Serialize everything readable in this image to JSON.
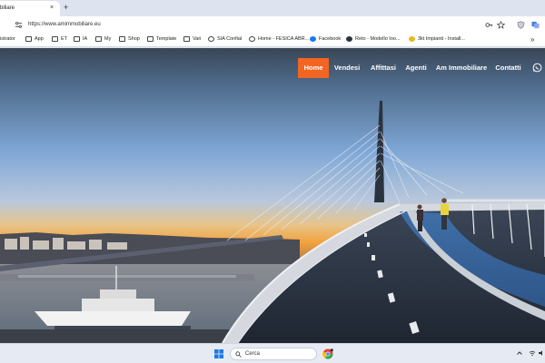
{
  "browser": {
    "tab_title": "biliare",
    "tab_close": "×",
    "new_tab": "+",
    "url": "https://www.amimmobiliare.eu",
    "bookmarks": [
      {
        "label": "istrator",
        "icon": "none"
      },
      {
        "label": "App",
        "icon": "folder-icon"
      },
      {
        "label": "ET",
        "icon": "folder-icon"
      },
      {
        "label": "IA",
        "icon": "folder-icon"
      },
      {
        "label": "My",
        "icon": "folder-icon"
      },
      {
        "label": "Shop",
        "icon": "folder-icon"
      },
      {
        "label": "Template",
        "icon": "folder-icon"
      },
      {
        "label": "Vari",
        "icon": "folder-icon"
      },
      {
        "label": "SIA Confial",
        "icon": "globe-icon"
      },
      {
        "label": "Home - FESICA ABR...",
        "icon": "globe-icon"
      },
      {
        "label": "Facebook",
        "icon": "facebook-icon"
      },
      {
        "label": "Reto - Modello Ioo...",
        "icon": "site-icon"
      },
      {
        "label": "3kt Impianti - Install...",
        "icon": "site-icon"
      }
    ],
    "bookmarks_more": "»"
  },
  "site": {
    "nav": [
      {
        "label": "Home",
        "active": true
      },
      {
        "label": "Vendesi",
        "active": false
      },
      {
        "label": "Affittasi",
        "active": false
      },
      {
        "label": "Agenti",
        "active": false
      },
      {
        "label": "Am Immobiliare",
        "active": false
      },
      {
        "label": "Contatti",
        "active": false
      }
    ],
    "accent_color": "#f26522"
  },
  "taskbar": {
    "search_placeholder": "Cerca"
  }
}
